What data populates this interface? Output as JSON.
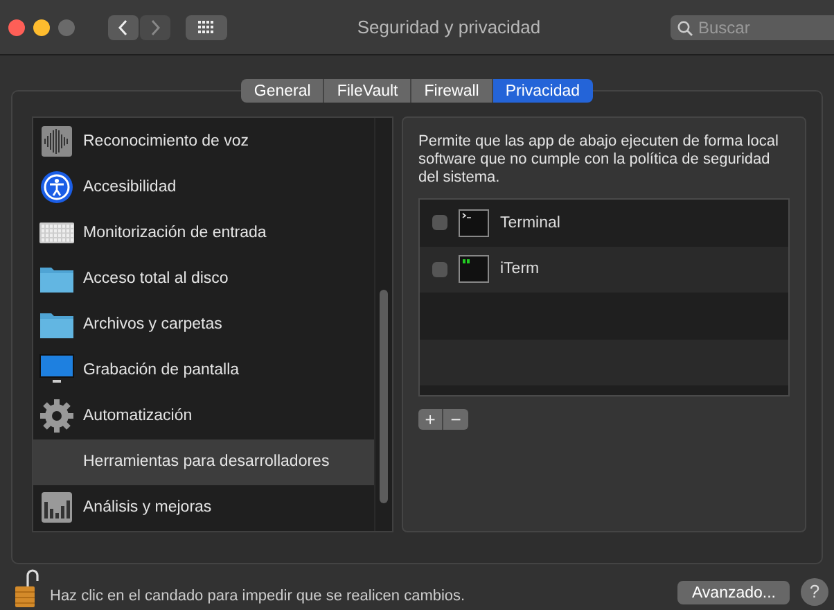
{
  "window": {
    "title": "Seguridad y privacidad",
    "search": {
      "placeholder": "Buscar"
    }
  },
  "tabs": [
    {
      "label": "General",
      "selected": false
    },
    {
      "label": "FileVault",
      "selected": false
    },
    {
      "label": "Firewall",
      "selected": false
    },
    {
      "label": "Privacidad",
      "selected": true
    }
  ],
  "sidebar": {
    "items": [
      {
        "label": "Reconocimiento de voz",
        "kind": "waveform",
        "selected": false
      },
      {
        "label": "Accesibilidad",
        "kind": "accessibility",
        "selected": false
      },
      {
        "label": "Monitorización de entrada",
        "kind": "keyboard",
        "selected": false
      },
      {
        "label": "Acceso total al disco",
        "kind": "folder",
        "selected": false
      },
      {
        "label": "Archivos y carpetas",
        "kind": "folder",
        "selected": false
      },
      {
        "label": "Grabación de pantalla",
        "kind": "display",
        "selected": false
      },
      {
        "label": "Automatización",
        "kind": "gear",
        "selected": false
      },
      {
        "label": "Herramientas para desarrolladores",
        "kind": "plain",
        "selected": true
      },
      {
        "label": "Análisis y mejoras",
        "kind": "chart",
        "selected": false
      }
    ]
  },
  "detail": {
    "description": "Permite que las app de abajo ejecuten de forma local software que no cumple con la política de seguridad del sistema.",
    "apps": [
      {
        "name": "Terminal",
        "kind": "terminal",
        "checked": false
      },
      {
        "name": "iTerm",
        "kind": "iterm",
        "checked": false
      }
    ],
    "add_button": "+",
    "remove_button": "−"
  },
  "footer": {
    "lock_text": "Haz clic en el candado para impedir que se realicen cambios.",
    "lock_open": true,
    "advanced_button": "Avanzado...",
    "help_button": "?"
  }
}
